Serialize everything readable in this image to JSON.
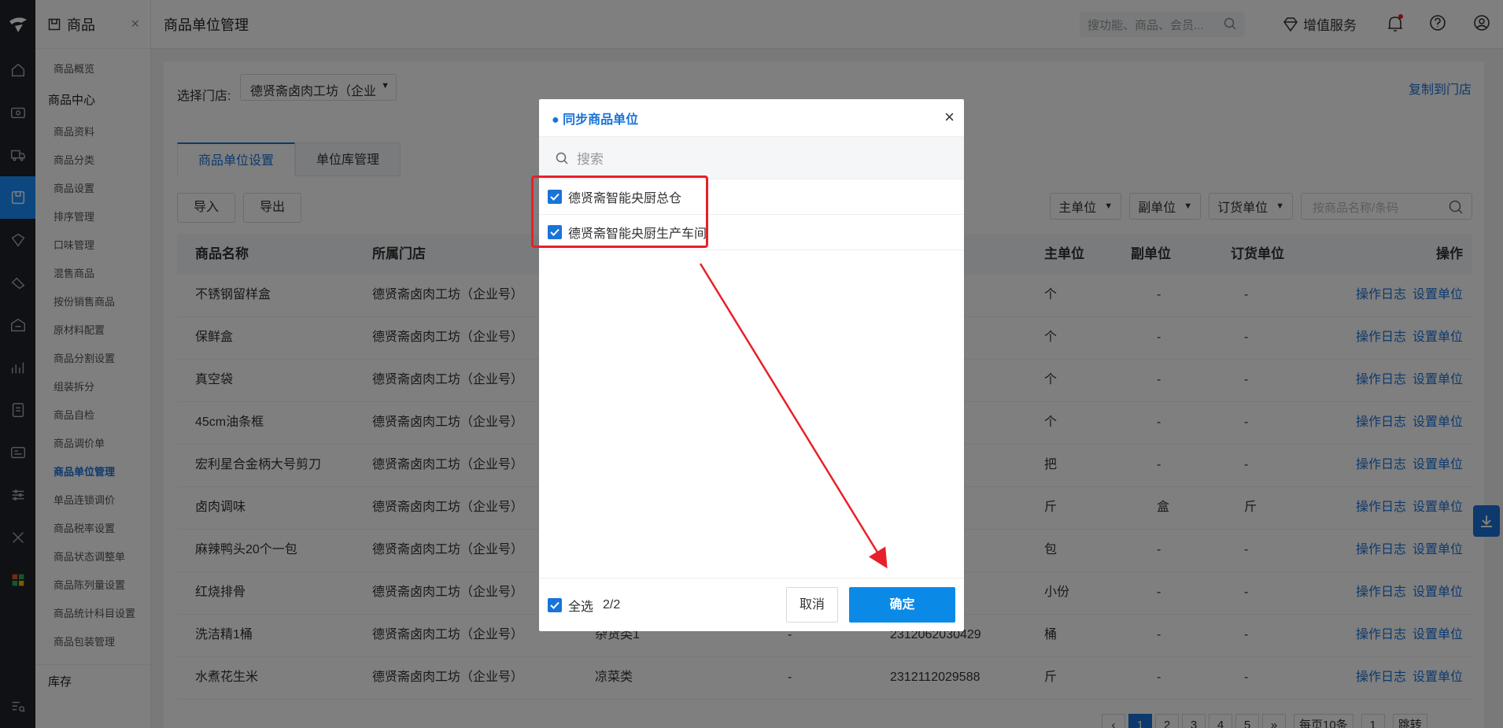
{
  "nav": {
    "module_title": "商品",
    "close": "×",
    "items": [
      {
        "label": "商品概览",
        "type": "item"
      },
      {
        "label": "商品中心",
        "type": "group"
      },
      {
        "label": "商品资料",
        "type": "item"
      },
      {
        "label": "商品分类",
        "type": "item"
      },
      {
        "label": "商品设置",
        "type": "item"
      },
      {
        "label": "排序管理",
        "type": "item"
      },
      {
        "label": "口味管理",
        "type": "item"
      },
      {
        "label": "混售商品",
        "type": "item"
      },
      {
        "label": "按份销售商品",
        "type": "item"
      },
      {
        "label": "原材料配置",
        "type": "item"
      },
      {
        "label": "商品分割设置",
        "type": "item"
      },
      {
        "label": "组装拆分",
        "type": "item"
      },
      {
        "label": "商品自检",
        "type": "item"
      },
      {
        "label": "商品调价单",
        "type": "item"
      },
      {
        "label": "商品单位管理",
        "type": "item",
        "active": true
      },
      {
        "label": "单品连锁调价",
        "type": "item"
      },
      {
        "label": "商品税率设置",
        "type": "item"
      },
      {
        "label": "商品状态调整单",
        "type": "item"
      },
      {
        "label": "商品陈列量设置",
        "type": "item"
      },
      {
        "label": "商品统计科目设置",
        "type": "item"
      },
      {
        "label": "商品包装管理",
        "type": "item"
      },
      {
        "label": "库存",
        "type": "group"
      }
    ]
  },
  "header": {
    "page_title": "商品单位管理",
    "search_placeholder": "搜功能、商品、会员...",
    "value_added": "增值服务"
  },
  "store_bar": {
    "label": "选择门店:",
    "selected": "德贤斋卤肉工坊（企业",
    "copy_link": "复制到门店"
  },
  "tabs": [
    "商品单位设置",
    "单位库管理"
  ],
  "buttons": {
    "import": "导入",
    "export": "导出"
  },
  "filters": {
    "main_unit": "主单位",
    "sub_unit": "副单位",
    "order_unit": "订货单位",
    "search_placeholder": "按商品名称/条码"
  },
  "table": {
    "headers": {
      "name": "商品名称",
      "store": "所属门店",
      "main_unit": "主单位",
      "sub_unit": "副单位",
      "order_unit": "订货单位",
      "ops": "操作"
    },
    "op_log": "操作日志",
    "op_set": "设置单位",
    "rows": [
      {
        "name": "不锈钢留样盒",
        "store": "德贤斋卤肉工坊（企业号）",
        "cat": "",
        "dash": "",
        "code": "",
        "main": "个",
        "sub": "-",
        "order": "-"
      },
      {
        "name": "保鲜盒",
        "store": "德贤斋卤肉工坊（企业号）",
        "cat": "",
        "dash": "",
        "code": "",
        "main": "个",
        "sub": "-",
        "order": "-"
      },
      {
        "name": "真空袋",
        "store": "德贤斋卤肉工坊（企业号）",
        "cat": "",
        "dash": "",
        "code": "",
        "main": "个",
        "sub": "-",
        "order": "-"
      },
      {
        "name": "45cm油条框",
        "store": "德贤斋卤肉工坊（企业号）",
        "cat": "",
        "dash": "",
        "code": "",
        "main": "个",
        "sub": "-",
        "order": "-"
      },
      {
        "name": "宏利星合金柄大号剪刀",
        "store": "德贤斋卤肉工坊（企业号）",
        "cat": "",
        "dash": "",
        "code": "",
        "main": "把",
        "sub": "-",
        "order": "-"
      },
      {
        "name": "卤肉调味",
        "store": "德贤斋卤肉工坊（企业号）",
        "cat": "",
        "dash": "",
        "code": "",
        "main": "斤",
        "sub": "盒",
        "order": "斤"
      },
      {
        "name": "麻辣鸭头20个一包",
        "store": "德贤斋卤肉工坊（企业号）",
        "cat": "",
        "dash": "",
        "code": "",
        "main": "包",
        "sub": "-",
        "order": "-"
      },
      {
        "name": "红烧排骨",
        "store": "德贤斋卤肉工坊（企业号）",
        "cat": "",
        "dash": "",
        "code": "",
        "main": "小份",
        "sub": "-",
        "order": "-"
      },
      {
        "name": "洗洁精1桶",
        "store": "德贤斋卤肉工坊（企业号）",
        "cat": "杂货类1",
        "dash": "-",
        "code": "2312062030429",
        "main": "桶",
        "sub": "-",
        "order": "-"
      },
      {
        "name": "水煮花生米",
        "store": "德贤斋卤肉工坊（企业号）",
        "cat": "凉菜类",
        "dash": "-",
        "code": "2312112029588",
        "main": "斤",
        "sub": "-",
        "order": "-"
      }
    ]
  },
  "pager": {
    "pages": [
      "‹",
      "1",
      "2",
      "3",
      "4",
      "5",
      "»"
    ],
    "per_page": "每页10条",
    "goto_value": "1",
    "goto": "跳转"
  },
  "dialog": {
    "title": "● 同步商品单位",
    "close": "×",
    "search_placeholder": "搜索",
    "stores": [
      {
        "label": "德贤斋智能央厨总仓",
        "checked": true
      },
      {
        "label": "德贤斋智能央厨生产车间",
        "checked": true
      }
    ],
    "select_all": "全选",
    "count": "2/2",
    "cancel": "取消",
    "confirm": "确定"
  },
  "colors": {
    "accent": "#1a73d9",
    "confirm": "#0a8ae6",
    "annotation": "#e8202a"
  }
}
